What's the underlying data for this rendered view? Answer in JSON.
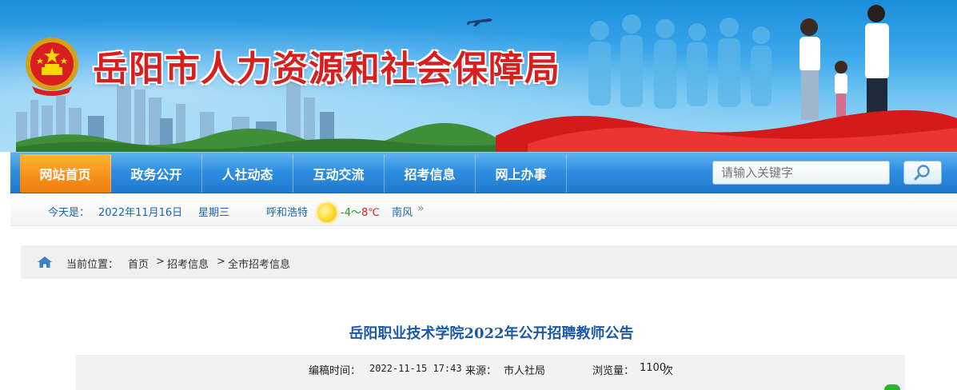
{
  "header": {
    "site_title": "岳阳市人力资源和社会保障局",
    "emblem_icon": "national-emblem-icon"
  },
  "nav": {
    "items": [
      {
        "label": "网站首页",
        "active": true
      },
      {
        "label": "政务公开",
        "active": false
      },
      {
        "label": "人社动态",
        "active": false
      },
      {
        "label": "互动交流",
        "active": false
      },
      {
        "label": "招考信息",
        "active": false
      },
      {
        "label": "网上办事",
        "active": false
      }
    ],
    "search_placeholder": "请输入关键字",
    "search_icon": "magnifier-icon"
  },
  "infobar": {
    "today_label": "今天是：",
    "date": "2022年11月16日",
    "weekday": "星期三",
    "city": "呼和浩特",
    "weather_icon": "sun-icon",
    "temp_low": "-4",
    "temp_sep": "～",
    "temp_high": "8",
    "temp_unit": "℃",
    "wind": "南风",
    "more_symbol": "»"
  },
  "breadcrumb": {
    "home_icon": "home-icon",
    "label": "当前位置：",
    "items": [
      "首页",
      "招考信息",
      "全市招考信息"
    ],
    "separator": ">"
  },
  "article": {
    "title": "岳阳职业技术学院2022年公开招聘教师公告",
    "meta": {
      "time_label": "编稿时间：",
      "time_value": "2022-11-15 17:43",
      "source_label": "来源：",
      "source_value": "市人社局",
      "views_label": "浏览量：",
      "views_value": "1100",
      "views_unit": "次"
    }
  },
  "colors": {
    "nav_active": "#f5901a",
    "nav_bg": "#2f8fe0",
    "title_red": "#d71f1f",
    "link_blue": "#1a67b0",
    "article_title": "#1c58a7"
  }
}
